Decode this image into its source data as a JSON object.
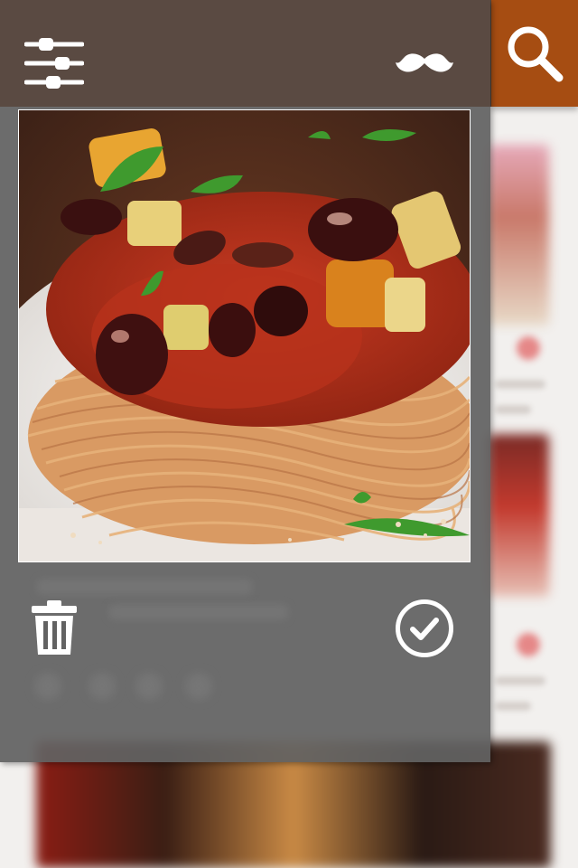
{
  "app": {
    "accent_color": "#a64d12",
    "header_color": "#5a4a42",
    "panel_color": "#626262"
  },
  "header": {
    "filter_icon": "sliders-icon",
    "mustache_icon": "mustache-icon",
    "search_icon": "search-icon"
  },
  "photo": {
    "subject": "spaghetti-with-tomato-olive-sauce"
  },
  "actions": {
    "delete_icon": "trash-icon",
    "confirm_icon": "check-circle-icon"
  }
}
